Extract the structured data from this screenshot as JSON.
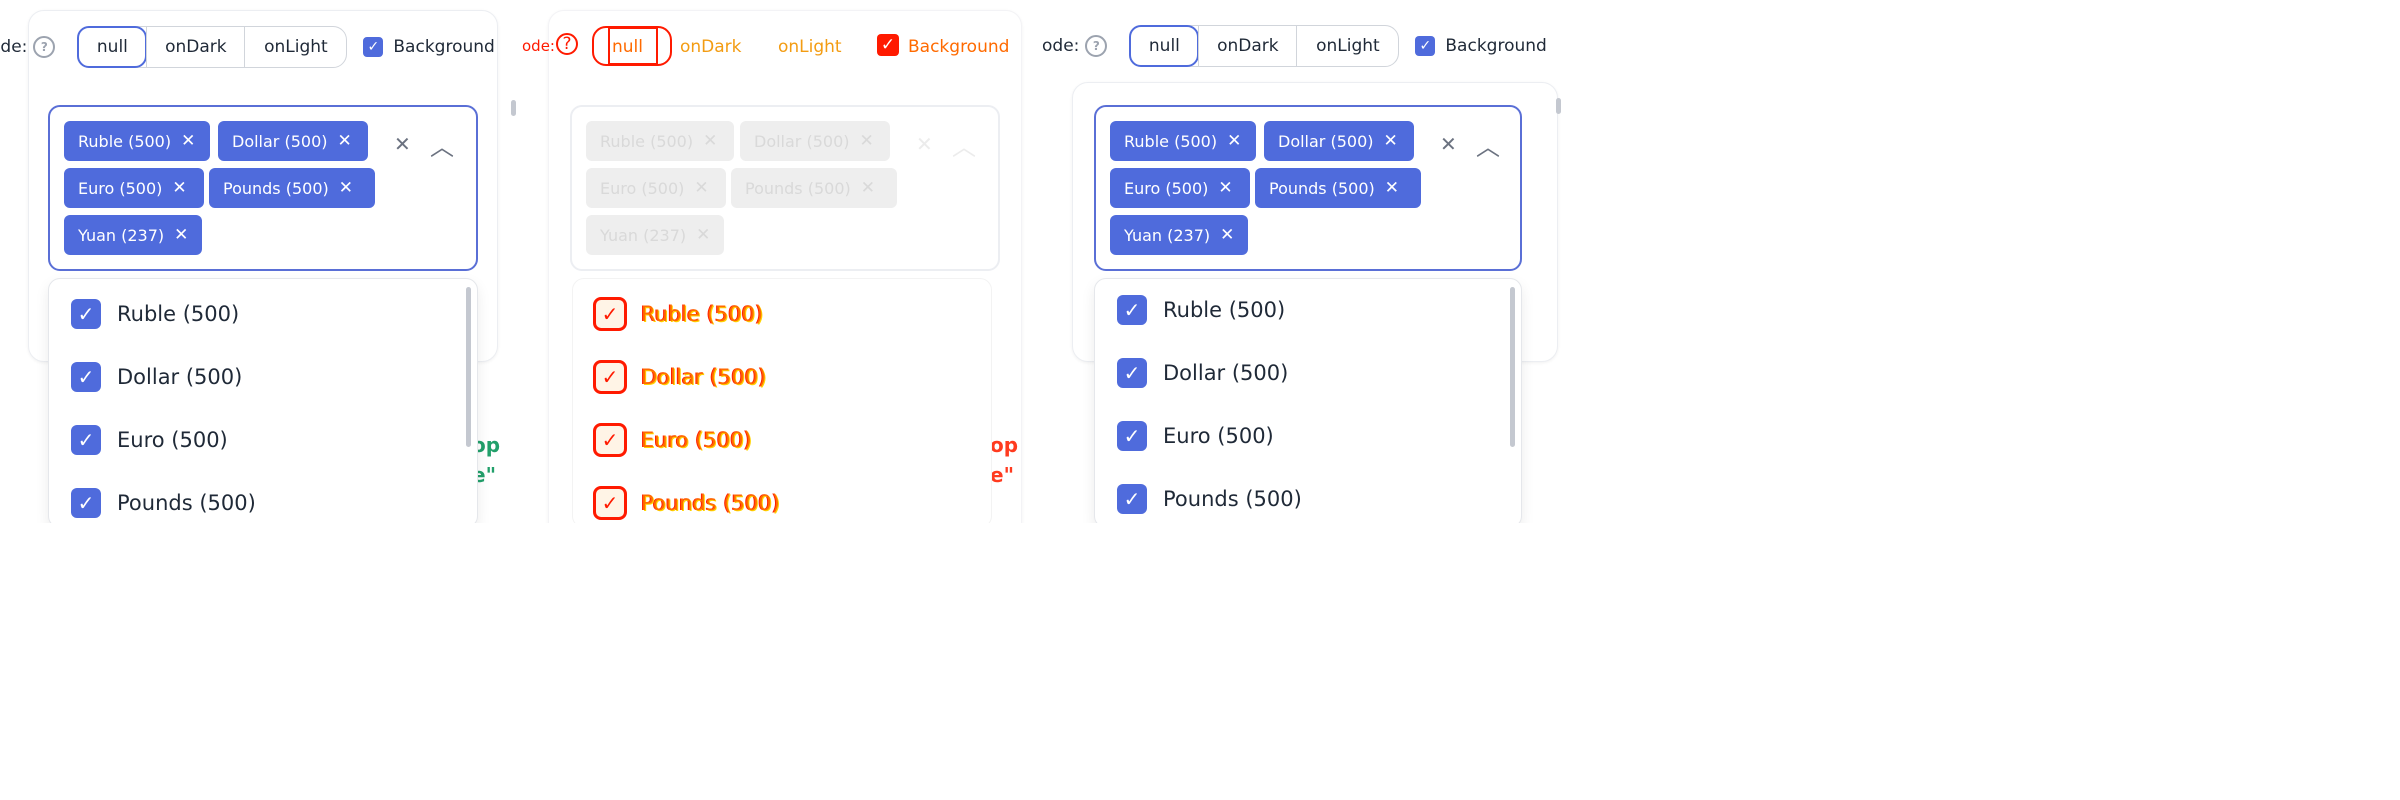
{
  "toolbar": {
    "mode_label": "ode:",
    "mode_label_right": "ode:",
    "help": "?",
    "segments": [
      "null",
      "onDark",
      "onLight"
    ],
    "active_segment": "null",
    "background_label": "Background",
    "background_checked": true
  },
  "chips": [
    "Ruble (500)",
    "Dollar (500)",
    "Euro (500)",
    "Pounds (500)",
    "Yuan (237)"
  ],
  "chip_remove": "✕",
  "clear_icon": "✕",
  "collapse_icon": "︿",
  "options": [
    "Ruble (500)",
    "Dollar (500)",
    "Euro (500)",
    "Pounds (500)"
  ],
  "check_glyph": "✓",
  "behind_text": [
    "op",
    "e\""
  ],
  "colors": {
    "accent": "#4f6bdc",
    "diff_red": "#ff1a00",
    "diff_orange": "#f39c12",
    "ghost_green": "#22a06b",
    "ghost_red": "#ff3b1f"
  }
}
